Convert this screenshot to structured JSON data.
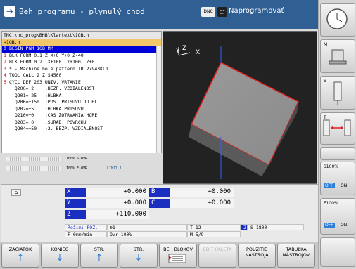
{
  "header": {
    "title": "Beh programu - plynulý chod",
    "dnc": "DNC",
    "pgm_badge": "PGM MGT",
    "right_title": "Naprogramovať"
  },
  "program": {
    "path": "TNC:\\nc_prog\\BHB\\Klartext\\1GB.h",
    "file": "→1GB.h",
    "lines": [
      {
        "n": "0",
        "text": "BEGIN PGM 1GB MM",
        "selected": true
      },
      {
        "n": "1",
        "text": "BLK FORM 0.1 Z X+0 Y+0 Z-40"
      },
      {
        "n": "2",
        "text": "BLK FORM 0.2  X+100  Y+100  Z+0"
      },
      {
        "n": "3",
        "text": "* - Machine hole pattern IR 27943KL1"
      },
      {
        "n": "4",
        "text": "TOOL CALL 2 Z S4500"
      },
      {
        "n": "5",
        "text": "CYCL DEF 203 UNIV. VRTANIE"
      },
      {
        "n": "",
        "text": "  Q200=+2    ;BEZP. VZDIALENOST"
      },
      {
        "n": "",
        "text": "  Q201=-25   ;HLBKA"
      },
      {
        "n": "",
        "text": "  Q206=+150  ;POS. PRISUVU DO HL."
      },
      {
        "n": "",
        "text": "  Q202=+5    ;HLBKA PRISUVU"
      },
      {
        "n": "",
        "text": "  Q210=+0    ;CAS ZOTRVANIA HORE"
      },
      {
        "n": "",
        "text": "  Q203=+0    ;SURAD. POVRCHU"
      },
      {
        "n": "",
        "text": "  Q204=+50   ;2. BEZP. VZDIALENOST"
      }
    ]
  },
  "override": {
    "s": "100% S-OVR",
    "f": "100% F-OVR",
    "limit": "LIMIT 1"
  },
  "graphics": {
    "axis_y": "Y",
    "axis_z": "Z",
    "axis_x": "X"
  },
  "status": {
    "axes": [
      {
        "name": "X",
        "value": "+0.000"
      },
      {
        "name": "B",
        "value": "+0.000"
      },
      {
        "name": "Y",
        "value": "+0.000"
      },
      {
        "name": "C",
        "value": "+0.000"
      },
      {
        "name": "Z",
        "value": "+110.000"
      }
    ],
    "mode": "Režim: POŽ.",
    "t_icon": "⊕1",
    "tool": "T 12",
    "spindle_label": "Z",
    "spindle": "S 1800",
    "feed": "F 0mm/min",
    "ovr": "Ovr 100%",
    "m": "M 5/9"
  },
  "softkeys": [
    {
      "label": "ZAČIATOK",
      "arrow": "↑",
      "enabled": true
    },
    {
      "label": "KONIEC",
      "arrow": "↓",
      "enabled": true
    },
    {
      "label": "STR.",
      "arrow": "↑",
      "enabled": true
    },
    {
      "label": "STR.",
      "arrow": "↓",
      "enabled": true
    },
    {
      "label": "BEH BLOKOV",
      "arrow": "",
      "enabled": true
    },
    {
      "label": "EDIT PALETA",
      "arrow": "",
      "enabled": false
    },
    {
      "label": "POUŽITIE NÁSTROJA",
      "arrow": "",
      "enabled": true
    },
    {
      "label": "TABUĽKA NÁSTROJOV",
      "arrow": "",
      "enabled": true
    }
  ],
  "right_column": {
    "m": "M",
    "s": "S",
    "t": "T",
    "s_override": "S100%",
    "off1": "OFF",
    "on1": "ON",
    "f_override": "F100%",
    "off2": "OFF",
    "on2": "ON"
  },
  "colors": {
    "header_bg": "#2f5f93",
    "selected_line": "#0000d8",
    "axis_label": "#1a2fc0"
  }
}
